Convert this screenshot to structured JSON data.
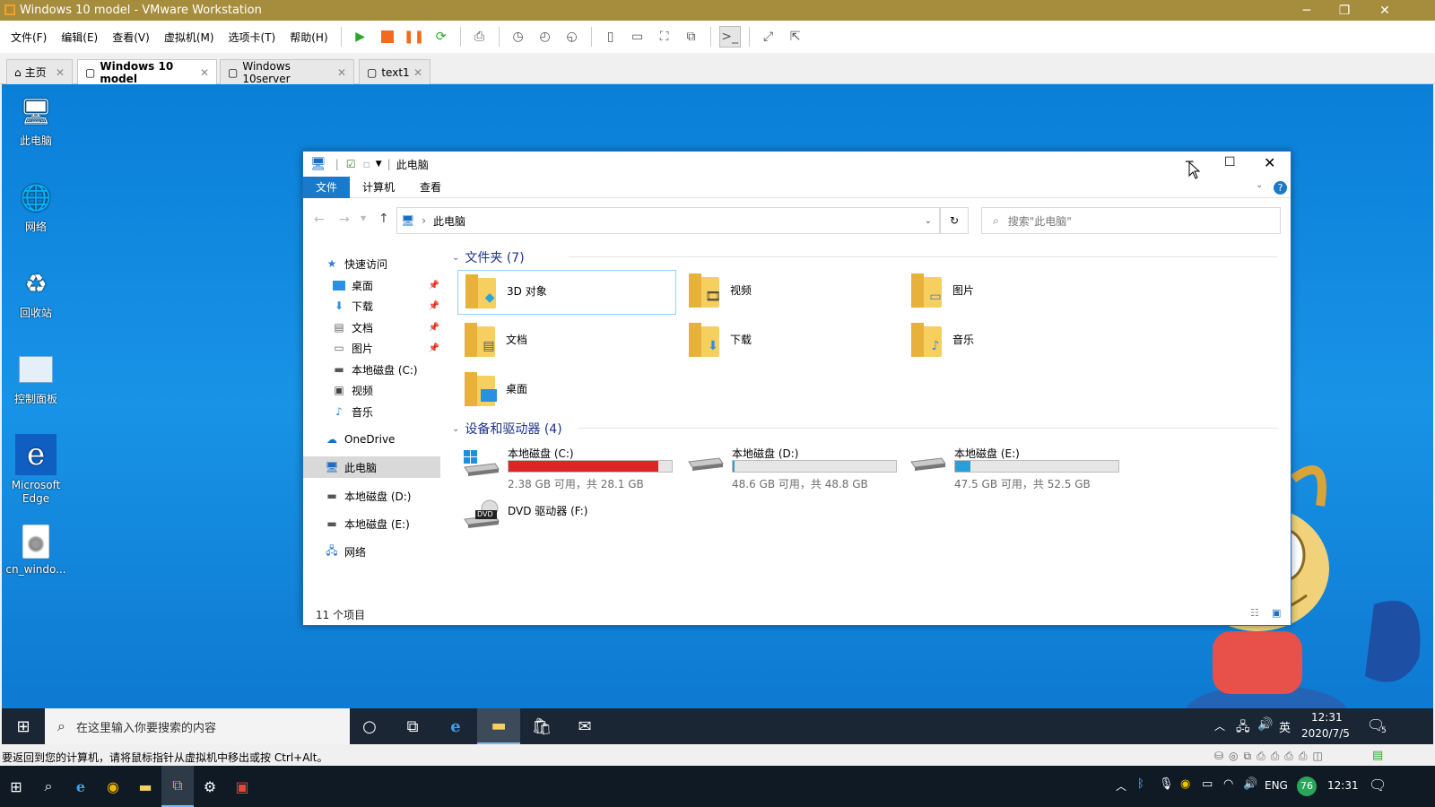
{
  "vm_window": {
    "title": "Windows 10 model - VMware Workstation",
    "menu": [
      "文件(F)",
      "编辑(E)",
      "查看(V)",
      "虚拟机(M)",
      "选项卡(T)",
      "帮助(H)"
    ],
    "tabs": [
      {
        "label": "主页",
        "active": false
      },
      {
        "label": "Windows 10 model",
        "active": true
      },
      {
        "label": "Windows 10server",
        "active": false
      },
      {
        "label": "text1",
        "active": false
      }
    ],
    "status_text": "要返回到您的计算机，请将鼠标指针从虚拟机中移出或按 Ctrl+Alt。"
  },
  "desktop": {
    "icons": [
      {
        "label": "此电脑",
        "icon": "computer-icon"
      },
      {
        "label": "网络",
        "icon": "network-icon"
      },
      {
        "label": "回收站",
        "icon": "recycle-bin-icon"
      },
      {
        "label": "控制面板",
        "icon": "control-panel-icon"
      },
      {
        "label": "Microsoft Edge",
        "icon": "edge-icon"
      },
      {
        "label": "cn_windo...",
        "icon": "disc-image-icon"
      }
    ]
  },
  "explorer": {
    "title": "此电脑",
    "ribbon_tabs": [
      "文件",
      "计算机",
      "查看"
    ],
    "address_path": "此电脑",
    "search_placeholder": "搜索\"此电脑\"",
    "nav": {
      "quick_access": "快速访问",
      "quick_items": [
        "桌面",
        "下载",
        "文档",
        "图片",
        "本地磁盘 (C:)",
        "视频",
        "音乐"
      ],
      "onedrive": "OneDrive",
      "this_pc": "此电脑",
      "drive_d": "本地磁盘 (D:)",
      "drive_e": "本地磁盘 (E:)",
      "network": "网络"
    },
    "folders_header": "文件夹 (7)",
    "folders": [
      "3D 对象",
      "视频",
      "图片",
      "文档",
      "下载",
      "音乐",
      "桌面"
    ],
    "drives_header": "设备和驱动器 (4)",
    "drives": [
      {
        "name": "本地磁盘 (C:)",
        "info": "2.38 GB 可用，共 28.1 GB",
        "used_fraction": 0.92,
        "bar_color": "#da2626"
      },
      {
        "name": "本地磁盘 (D:)",
        "info": "48.6 GB 可用，共 48.8 GB",
        "used_fraction": 0.004,
        "bar_color": "#26a0da"
      },
      {
        "name": "本地磁盘 (E:)",
        "info": "47.5 GB 可用，共 52.5 GB",
        "used_fraction": 0.095,
        "bar_color": "#26a0da"
      }
    ],
    "dvd": {
      "name": "DVD 驱动器 (F:)",
      "badge": "DVD"
    },
    "status": "11 个项目"
  },
  "guest_taskbar": {
    "search_placeholder": "在这里输入你要搜索的内容",
    "ime": "英",
    "time": "12:31",
    "date": "2020/7/5",
    "notifications": "5"
  },
  "host_taskbar": {
    "lang": "ENG",
    "battery_badge": "76",
    "time": "12:31"
  }
}
